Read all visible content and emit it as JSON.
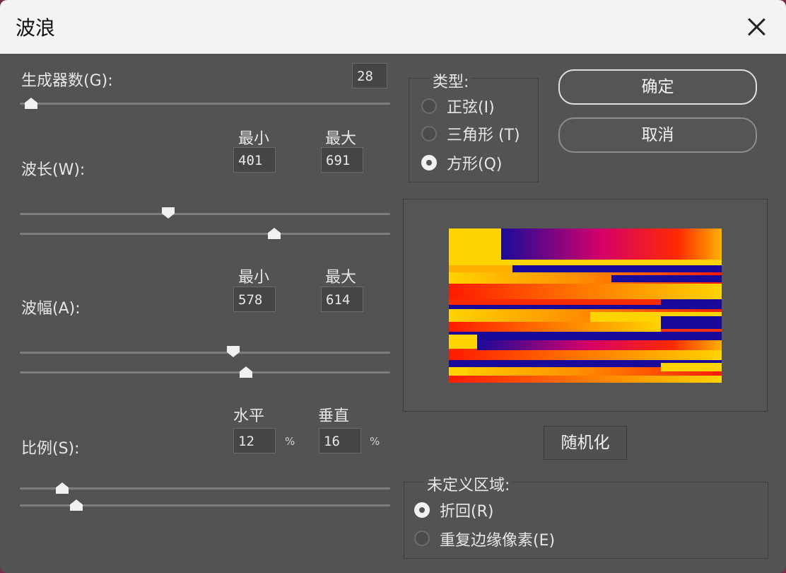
{
  "window": {
    "title": "波浪"
  },
  "generators": {
    "label": "生成器数(G):",
    "value": "28"
  },
  "wavelength": {
    "label": "波长(W):",
    "min_label": "最小",
    "max_label": "最大",
    "min": "401",
    "max": "691"
  },
  "amplitude": {
    "label": "波幅(A):",
    "min_label": "最小",
    "max_label": "最大",
    "min": "578",
    "max": "614"
  },
  "scale": {
    "label": "比例(S):",
    "h_label": "水平",
    "v_label": "垂直",
    "h": "12",
    "v": "16",
    "unit": "%"
  },
  "type": {
    "legend": "类型:",
    "options": [
      "正弦(I)",
      "三角形 (T)",
      "方形(Q)"
    ],
    "selected": "方形(Q)"
  },
  "buttons": {
    "ok": "确定",
    "cancel": "取消",
    "randomize": "随机化"
  },
  "undefined_area": {
    "legend": "未定义区域:",
    "options": [
      "折回(R)",
      "重复边缘像素(E)"
    ],
    "selected": "折回(R)"
  },
  "colors": {
    "dialog_bg": "#535353",
    "titlebar_bg": "#f3f3f3",
    "preview_yellow": "#ffd400",
    "preview_red": "#ff1a00",
    "preview_navy": "#1a0a9a"
  }
}
